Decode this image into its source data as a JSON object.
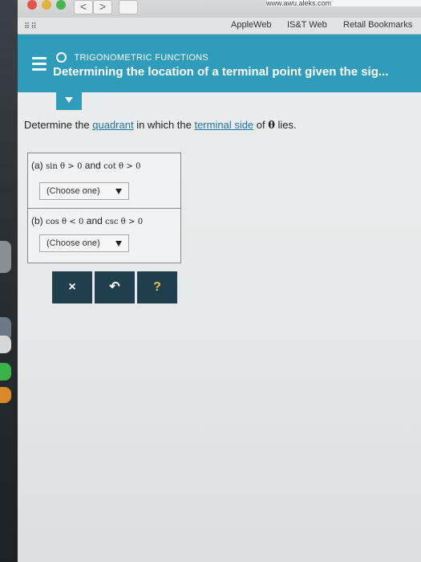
{
  "browser": {
    "url_fragment": "www.awu.aleks.com",
    "nav_back": "<",
    "nav_forward": ">",
    "bookmarks": [
      "AppleWeb",
      "IS&T Web",
      "Retail Bookmarks"
    ]
  },
  "header": {
    "section": "TRIGONOMETRIC FUNCTIONS",
    "title": "Determining the location of a terminal point given the sig..."
  },
  "question": {
    "prefix": "Determine the ",
    "link1": "quadrant",
    "middle": " in which the ",
    "link2": "terminal side",
    "of": " of ",
    "theta": "θ",
    "suffix": " lies.",
    "parts": [
      {
        "label": "(a)",
        "fn1": "sin θ",
        "cmp1": ">",
        "val1": "0",
        "and": "and",
        "fn2": "cot θ",
        "cmp2": ">",
        "val2": "0",
        "select_value": "(Choose one)"
      },
      {
        "label": "(b)",
        "fn1": "cos θ",
        "cmp1": "<",
        "val1": "0",
        "and": "and",
        "fn2": "csc θ",
        "cmp2": ">",
        "val2": "0",
        "select_value": "(Choose one)"
      }
    ]
  },
  "actions": {
    "clear": "×",
    "undo": "↶",
    "help": "?"
  },
  "colors": {
    "header": "#2f9cbc",
    "link": "#1d76a8",
    "action_button": "#1f3e4e"
  },
  "icons": [
    "menu-icon",
    "circle-icon",
    "dropdown-arrow-icon",
    "grid-icon",
    "clear-icon",
    "undo-icon",
    "help-icon"
  ]
}
